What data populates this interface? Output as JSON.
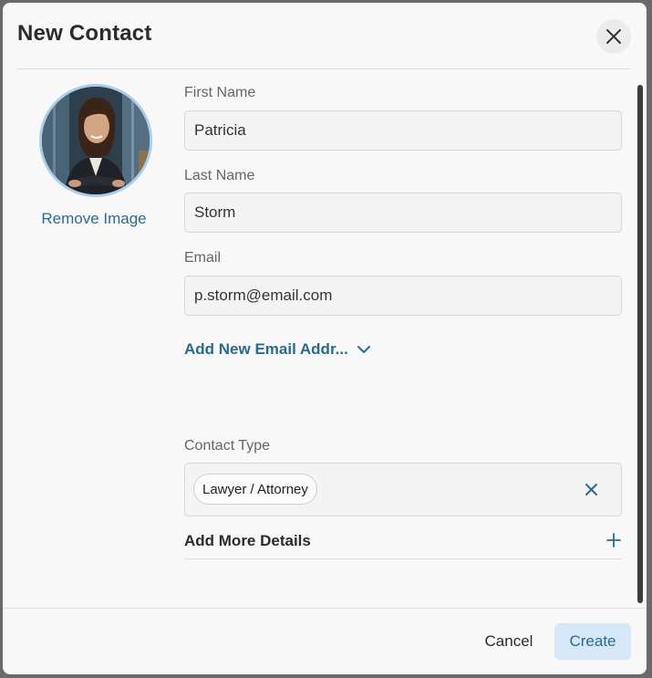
{
  "dialog": {
    "title": "New Contact",
    "close_icon": "close-icon"
  },
  "avatar": {
    "remove_label": "Remove Image"
  },
  "fields": {
    "first_name": {
      "label": "First Name",
      "value": "Patricia"
    },
    "last_name": {
      "label": "Last Name",
      "value": "Storm"
    },
    "email": {
      "label": "Email",
      "value": "p.storm@email.com"
    }
  },
  "add_email": {
    "label": "Add New Email Addr...",
    "icon": "chevron-down-icon"
  },
  "contact_type": {
    "label": "Contact Type",
    "selected": "Lawyer / Attorney",
    "clear_icon": "close-icon"
  },
  "more_details": {
    "label": "Add More Details",
    "icon": "plus-icon"
  },
  "footer": {
    "cancel_label": "Cancel",
    "create_label": "Create"
  },
  "colors": {
    "accent": "#2a6a8f",
    "primary_button_bg": "#d6e8f7",
    "avatar_ring": "#a9cdea"
  }
}
